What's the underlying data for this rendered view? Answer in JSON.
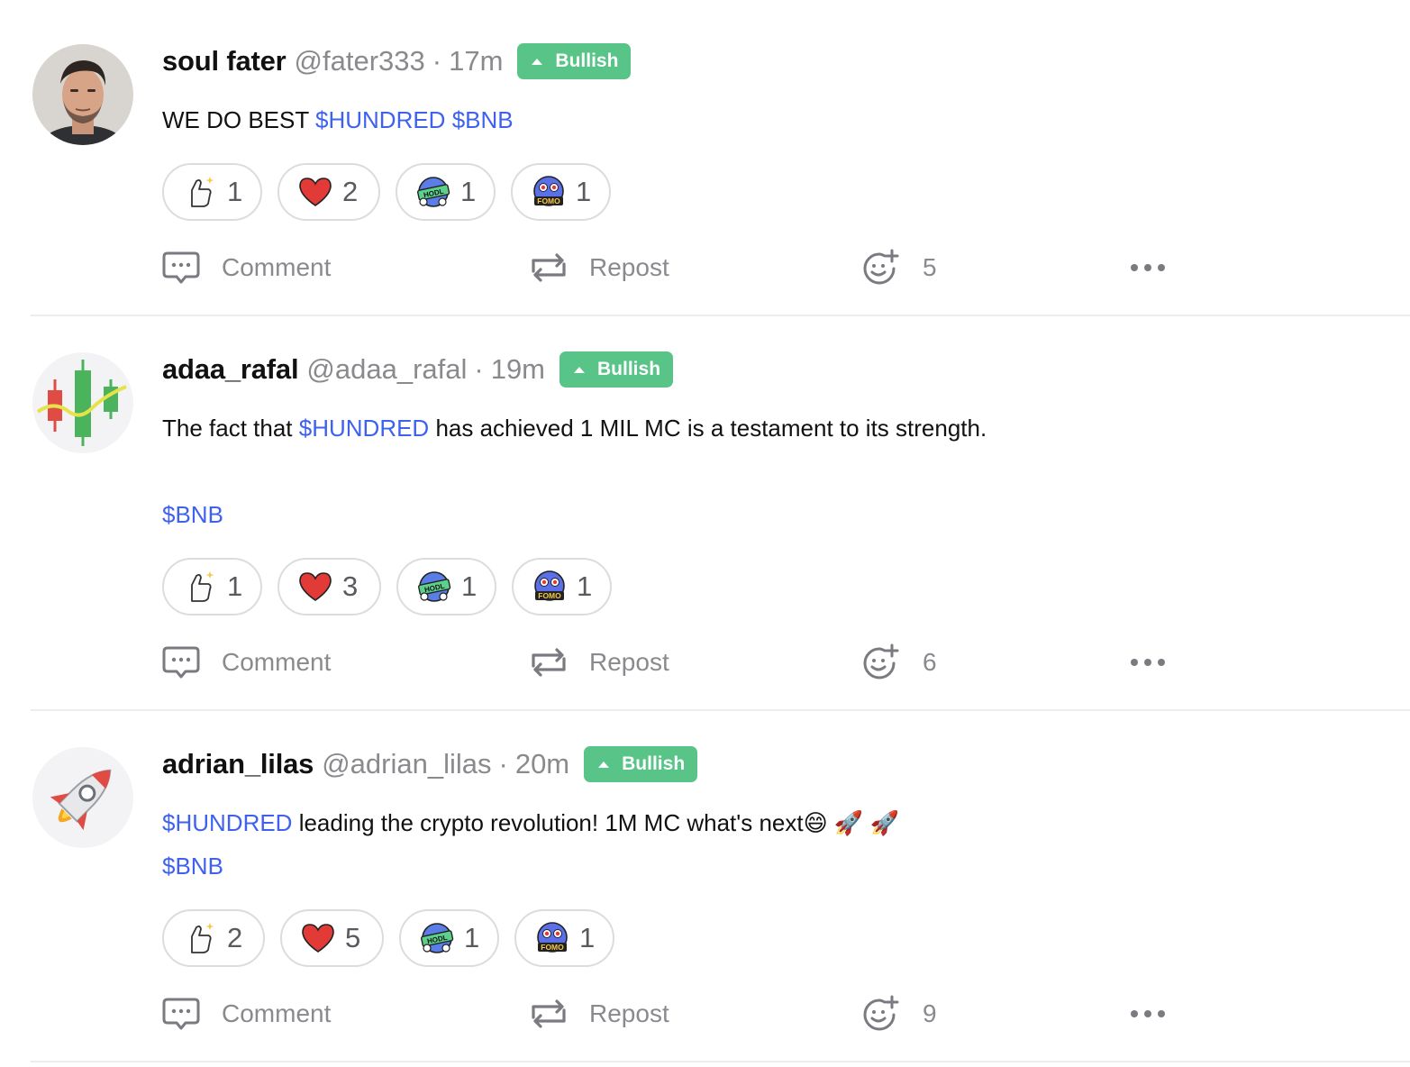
{
  "posts": [
    {
      "author": "soul fater",
      "handle": "@fater333",
      "separator": "·",
      "time": "17m",
      "sentiment": "Bullish",
      "avatar": "man-portrait-avatar",
      "lines": [
        {
          "parts": [
            {
              "t": "WE DO BEST "
            },
            {
              "t": "$HUNDRED",
              "tag": true
            },
            {
              "t": " "
            },
            {
              "t": "$BNB",
              "tag": true
            }
          ]
        }
      ],
      "reactions": [
        {
          "icon": "thumbs-up-icon",
          "count": "1"
        },
        {
          "icon": "heart-icon",
          "count": "2"
        },
        {
          "icon": "hodl-icon",
          "count": "1"
        },
        {
          "icon": "fomo-icon",
          "count": "1"
        }
      ],
      "actions": {
        "comment": "Comment",
        "repost": "Repost",
        "react_count": "5"
      }
    },
    {
      "author": "adaa_rafal",
      "handle": "@adaa_rafal",
      "separator": "·",
      "time": "19m",
      "sentiment": "Bullish",
      "avatar": "candlestick-chart-avatar",
      "lines": [
        {
          "parts": [
            {
              "t": "The fact that "
            },
            {
              "t": "$HUNDRED",
              "tag": true
            },
            {
              "t": " has achieved 1 MIL MC is a testament to its strength."
            }
          ]
        },
        {
          "parts": [
            {
              "t": "$BNB",
              "tag": true
            }
          ]
        }
      ],
      "reactions": [
        {
          "icon": "thumbs-up-icon",
          "count": "1"
        },
        {
          "icon": "heart-icon",
          "count": "3"
        },
        {
          "icon": "hodl-icon",
          "count": "1"
        },
        {
          "icon": "fomo-icon",
          "count": "1"
        }
      ],
      "actions": {
        "comment": "Comment",
        "repost": "Repost",
        "react_count": "6"
      }
    },
    {
      "author": "adrian_lilas",
      "handle": "@adrian_lilas",
      "separator": "·",
      "time": "20m",
      "sentiment": "Bullish",
      "avatar": "rocket-avatar",
      "lines": [
        {
          "parts": [
            {
              "t": "$HUNDRED",
              "tag": true
            },
            {
              "t": " leading the crypto revolution! 1M MC what's next😄 🚀 🚀"
            }
          ]
        },
        {
          "parts": [
            {
              "t": "$BNB",
              "tag": true
            }
          ]
        }
      ],
      "reactions": [
        {
          "icon": "thumbs-up-icon",
          "count": "2"
        },
        {
          "icon": "heart-icon",
          "count": "5"
        },
        {
          "icon": "hodl-icon",
          "count": "1"
        },
        {
          "icon": "fomo-icon",
          "count": "1"
        }
      ],
      "actions": {
        "comment": "Comment",
        "repost": "Repost",
        "react_count": "9"
      }
    }
  ],
  "colors": {
    "bullish": "#58c488",
    "tag": "#3e62ee",
    "muted": "#8a8a8e",
    "divider": "#ececec"
  }
}
